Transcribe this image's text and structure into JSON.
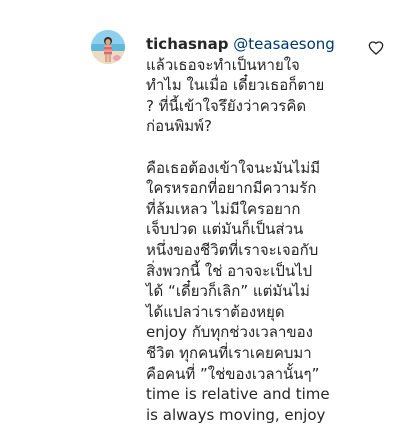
{
  "comment": {
    "username": "tichasnap",
    "mention": "@teasaesong",
    "first_line_rest": "",
    "paragraph1": [
      "แล้วเธอจะทำเป็นหายใจ",
      "ทำไม ในเมื่อ เดี๋ยวเธอก็ตาย",
      "? ที่นี้เข้าใจรึยังว่าควรคิด",
      "ก่อนพิมพ์?"
    ],
    "paragraph2": [
      "คือเธอต้องเข้าใจนะมันไม่มี",
      "ใครหรอกที่อยากมีความรัก",
      "ที่ล้มเหลว ไม่มีใครอยาก",
      "เจ็บปวด แต่มันก็เป็นส่วน",
      "หนึ่งของชีวิตที่เราจะเจอกับ",
      "สิ่งพวกนี้ ใช่ อาจจะเป็นไป",
      "ได้ “เดี๋ยวก็เลิก” แต่มันไม่",
      "ได้แปลว่าเราต้องหยุด",
      "enjoy กับทุกช่วงเวลาของ",
      "ชีวิต ทุกคนที่เราเคยคบมา",
      "คือคนที่ ”ใช่ของเวลานั้นๆ”",
      "time is relative and time",
      "is always moving, enjoy"
    ]
  },
  "icons": {
    "like": "heart-outline-icon",
    "avatar": "profile-avatar"
  },
  "colors": {
    "text": "#262626",
    "mention": "#00376b",
    "background": "#ffffff"
  }
}
